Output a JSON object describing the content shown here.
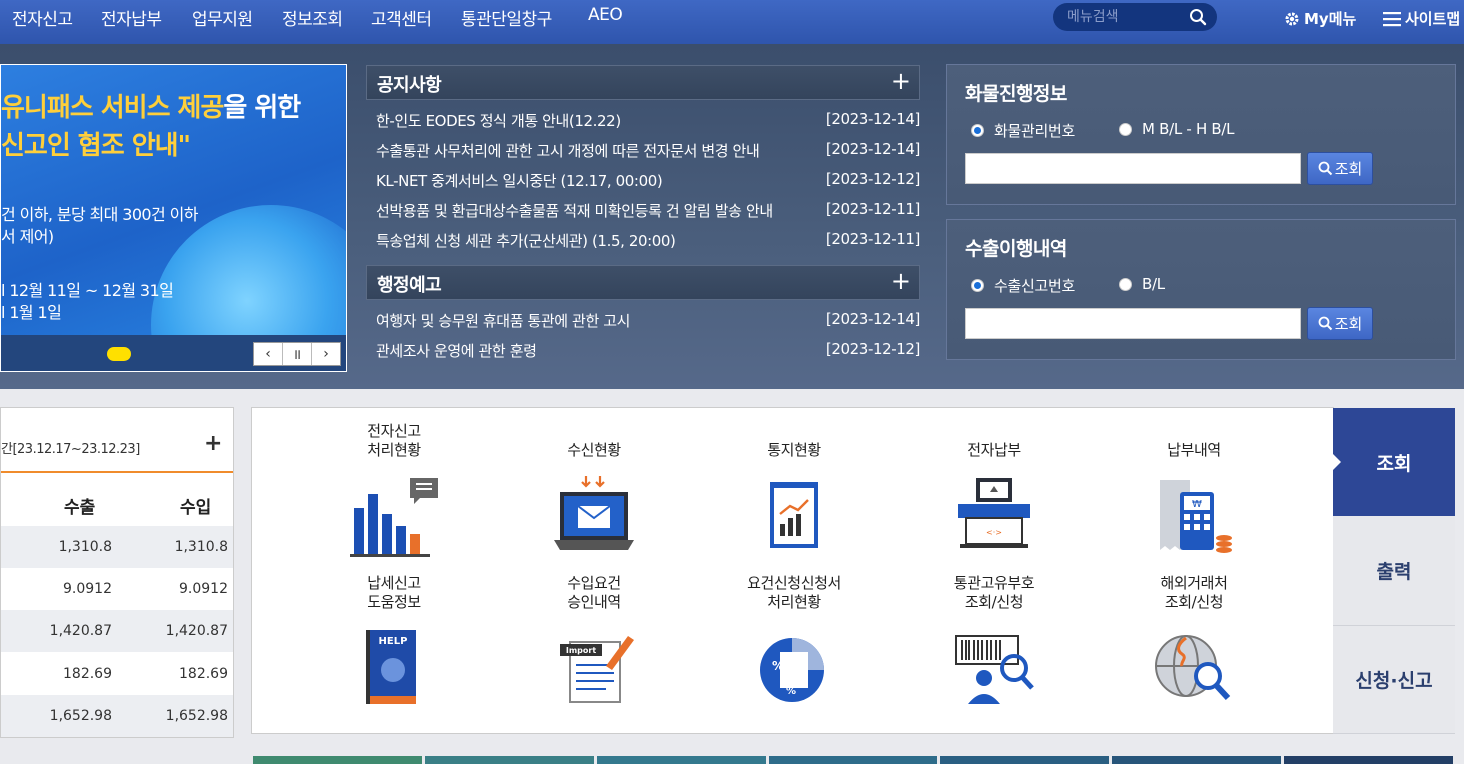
{
  "nav": {
    "items": [
      "전자신고",
      "전자납부",
      "업무지원",
      "정보조회",
      "고객센터",
      "통관단일창구",
      "AEO"
    ],
    "search_placeholder": "메뉴검색",
    "mymenu": "My메뉴",
    "sitemap": "사이트맵"
  },
  "banner": {
    "line1_highlight": "유니패스 서비스 제공",
    "line1_rest": "을 위한",
    "line2": "신고인 협조 안내\"",
    "lines": [
      "건 이하, 분당 최대 300건 이하",
      "서 제어)",
      "l 12월 11일 ~ 12월 31일",
      "l 1월 1일"
    ],
    "slider_controls": [
      "‹",
      "॥",
      "›"
    ]
  },
  "notice": {
    "title": "공지사항",
    "more": "+",
    "items": [
      {
        "title": "한-인도 EODES 정식 개통 안내(12.22)",
        "date": "[2023-12-14]"
      },
      {
        "title": "수출통관 사무처리에 관한 고시 개정에 따른 전자문서 변경 안내",
        "date": "[2023-12-14]"
      },
      {
        "title": "KL-NET 중계서비스 일시중단 (12.17, 00:00)",
        "date": "[2023-12-12]"
      },
      {
        "title": "선박용품 및 환급대상수출물품 적재 미확인등록 건 알림 발송 안내",
        "date": "[2023-12-11]"
      },
      {
        "title": "특송업체 신청 세관 추가(군산세관) (1.5, 20:00)",
        "date": "[2023-12-11]"
      }
    ]
  },
  "admin_notice": {
    "title": "행정예고",
    "more": "+",
    "items": [
      {
        "title": "여행자 및 승무원 휴대품 통관에 관한 고시",
        "date": "[2023-12-14]"
      },
      {
        "title": "관세조사 운영에 관한 훈령",
        "date": "[2023-12-12]"
      }
    ]
  },
  "cargo_progress": {
    "title": "화물진행정보",
    "options": [
      "화물관리번호",
      "M B/L - H B/L"
    ],
    "selected": 0,
    "input_value": "",
    "button": "조회"
  },
  "export_history": {
    "title": "수출이행내역",
    "options": [
      "수출신고번호",
      "B/L"
    ],
    "selected": 0,
    "input_value": "",
    "button": "조회"
  },
  "exchange": {
    "period": "간[23.12.17~23.12.23]",
    "more": "+",
    "headers": [
      "수출",
      "수입"
    ],
    "rows": [
      [
        "1,310.8",
        "1,310.8"
      ],
      [
        "9.0912",
        "9.0912"
      ],
      [
        "1,420.87",
        "1,420.87"
      ],
      [
        "182.69",
        "182.69"
      ],
      [
        "1,652.98",
        "1,652.98"
      ]
    ]
  },
  "services": [
    {
      "label": "전자신고\n처리현황",
      "icon": "bar-chart-icon"
    },
    {
      "label": "수신현황",
      "icon": "laptop-mail-icon"
    },
    {
      "label": "통지현황",
      "icon": "report-chart-icon"
    },
    {
      "label": "전자납부",
      "icon": "payment-terminal-icon"
    },
    {
      "label": "납부내역",
      "icon": "receipt-calculator-icon"
    },
    {
      "label": "납세신고\n도움정보",
      "icon": "help-book-icon"
    },
    {
      "label": "수입요건\n승인내역",
      "icon": "import-document-icon"
    },
    {
      "label": "요건신청신청서\n처리현황",
      "icon": "percent-chart-icon"
    },
    {
      "label": "통관고유부호\n조회/신청",
      "icon": "barcode-search-icon"
    },
    {
      "label": "해외거래처\n조회/신청",
      "icon": "globe-search-icon"
    }
  ],
  "side_tabs": [
    "조회",
    "출력",
    "신청·신고"
  ],
  "colors": {
    "nav": "#2f55ad",
    "accent_orange": "#f08c2c",
    "tab_active": "#2d4796",
    "banner_yellow": "#ffcf3a"
  }
}
